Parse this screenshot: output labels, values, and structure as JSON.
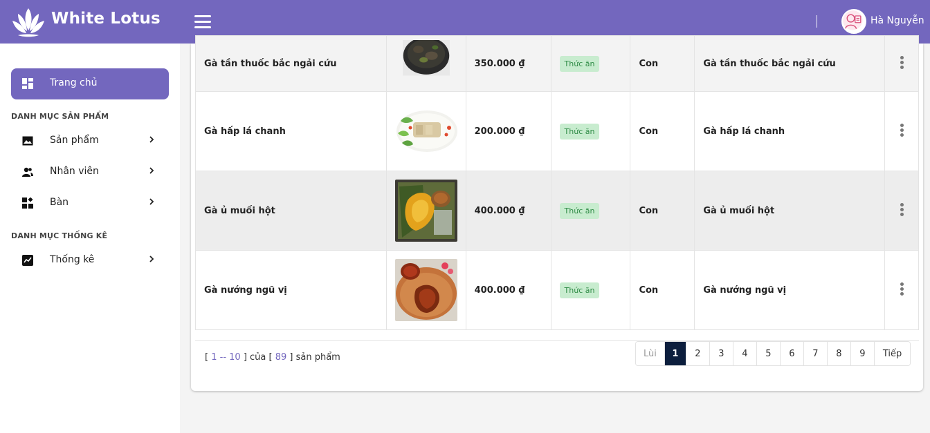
{
  "header": {
    "brand": "White Lotus",
    "user_name": "Hà Nguyễn",
    "brand_color": "#7367be"
  },
  "sidebar": {
    "active_item": {
      "label": "Trang chủ",
      "icon": "dashboard-icon"
    },
    "sections": [
      {
        "title": "DANH MỤC SẢN PHẨM",
        "items": [
          {
            "label": "Sản phẩm",
            "icon": "image-icon"
          },
          {
            "label": "Nhân viên",
            "icon": "users-icon"
          },
          {
            "label": "Bàn",
            "icon": "tables-icon"
          }
        ]
      },
      {
        "title": "DANH MỤC THỐNG KÊ",
        "items": [
          {
            "label": "Thống kê",
            "icon": "chart-icon"
          }
        ]
      }
    ]
  },
  "table": {
    "rows": [
      {
        "name": "Gà tần thuốc bắc ngải cứu",
        "price": "350.000 ₫",
        "category": "Thức ăn",
        "unit": "Con",
        "description": "Gà tần thuốc bắc ngải cứu"
      },
      {
        "name": "Gà hấp lá chanh",
        "price": "200.000 ₫",
        "category": "Thức ăn",
        "unit": "Con",
        "description": "Gà hấp lá chanh"
      },
      {
        "name": "Gà ủ muối hột",
        "price": "400.000 ₫",
        "category": "Thức ăn",
        "unit": "Con",
        "description": "Gà ủ muối hột"
      },
      {
        "name": "Gà nướng ngũ vị",
        "price": "400.000 ₫",
        "category": "Thức ăn",
        "unit": "Con",
        "description": "Gà nướng ngũ vị"
      }
    ]
  },
  "footer": {
    "range_open": "[ ",
    "range_text": "1 -- 10",
    "range_mid": " ] của [ ",
    "total": "89",
    "range_close": " ] sản phẩm"
  },
  "pagination": {
    "prev": "Lùi",
    "pages": [
      "1",
      "2",
      "3",
      "4",
      "5",
      "6",
      "7",
      "8",
      "9"
    ],
    "current": "1",
    "next": "Tiếp"
  }
}
